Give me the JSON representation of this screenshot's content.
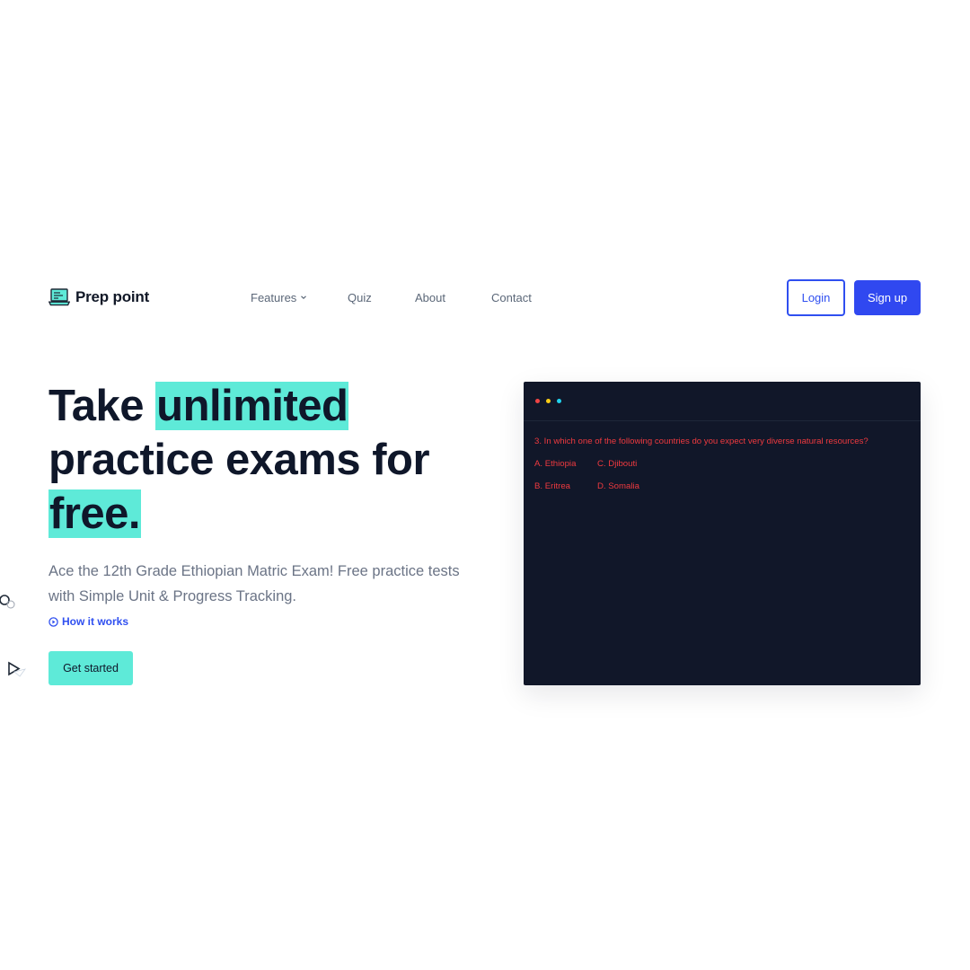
{
  "brand": {
    "name": "Prep point",
    "logo_icon": "laptop-icon"
  },
  "nav": [
    {
      "label": "Features",
      "has_dropdown": true
    },
    {
      "label": "Quiz"
    },
    {
      "label": "About"
    },
    {
      "label": "Contact"
    }
  ],
  "auth": {
    "login_label": "Login",
    "signup_label": "Sign up"
  },
  "hero": {
    "headline_part1": "Take ",
    "headline_highlight1": "unlimited",
    "headline_part2": "practice exams for",
    "headline_highlight2": "free.",
    "subtitle": "Ace the 12th Grade Ethiopian Matric Exam! Free practice tests with Simple Unit & Progress Tracking.",
    "how_link": "How it works",
    "cta_label": "Get started"
  },
  "window": {
    "dot_colors": [
      "#ef4444",
      "#facc15",
      "#22d3ee"
    ],
    "question": "3. In which one of the following countries do you expect very diverse natural resources?",
    "options": [
      {
        "a": "A. Ethiopia",
        "b": "C. Djibouti"
      },
      {
        "a": "B. Eritrea",
        "b": "D. Somalia"
      }
    ]
  },
  "colors": {
    "accent": "#5eead8",
    "primary": "#3048f0",
    "dark": "#111729",
    "question_text": "#ef3a3f"
  }
}
